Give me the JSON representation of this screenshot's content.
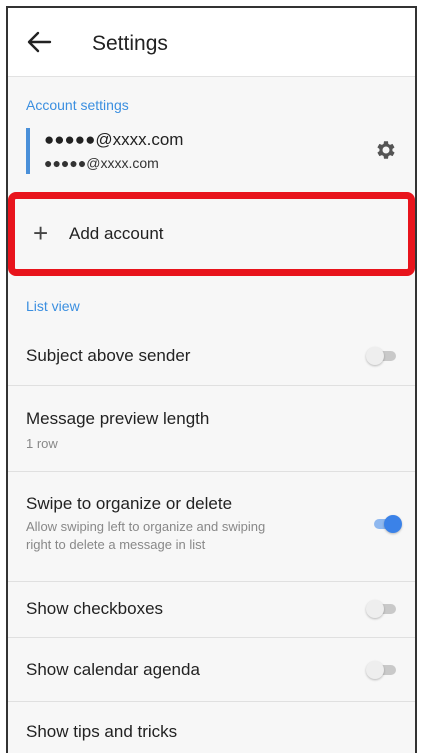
{
  "appbar": {
    "title": "Settings"
  },
  "account_section": {
    "header": "Account settings",
    "primary_email": "●●●●●@xxxx.com",
    "secondary_email": "●●●●●@xxxx.com",
    "add_account_label": "Add account"
  },
  "list_view": {
    "header": "List view",
    "items": [
      {
        "title": "Subject above sender",
        "toggle": false
      },
      {
        "title": "Message preview length",
        "subtitle": "1 row"
      },
      {
        "title": "Swipe to organize or delete",
        "subtitle_line1": "Allow swiping left to organize and swiping",
        "subtitle_line2": "right to delete a message in list",
        "toggle": true
      },
      {
        "title": "Show checkboxes",
        "toggle": false
      },
      {
        "title": "Show calendar agenda",
        "toggle": false
      },
      {
        "title": "Show tips and tricks"
      }
    ]
  },
  "colors": {
    "accent": "#3b8fe0",
    "highlight": "#e8141c",
    "toggle_on": "#3b82e8"
  }
}
